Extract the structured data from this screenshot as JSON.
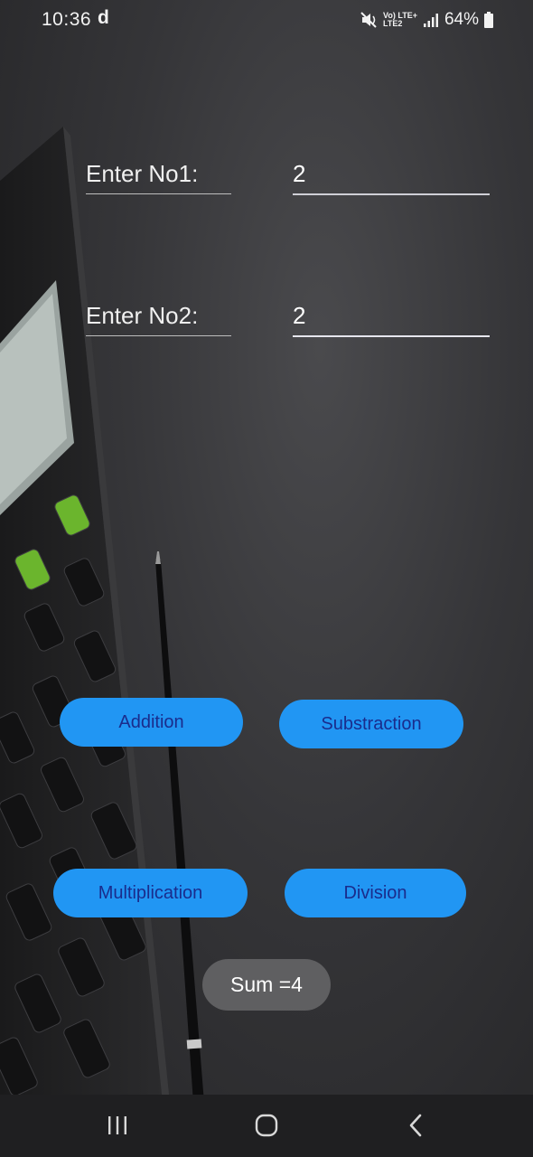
{
  "status_bar": {
    "time": "10:36",
    "app_indicator": "d",
    "network_line1": "Vo) LTE+",
    "network_line2": "LTE2",
    "battery_percent": "64%",
    "icons": [
      "mute-icon",
      "signal-icon",
      "battery-icon"
    ]
  },
  "form": {
    "label1": "Enter No1:",
    "value1": "2",
    "label2": "Enter No2:",
    "value2": "2"
  },
  "buttons": {
    "addition": "Addition",
    "subtraction": "Substraction",
    "multiplication": "Multiplication",
    "division": "Division"
  },
  "toast": {
    "message": "Sum =4"
  },
  "nav": {
    "icons": [
      "recents-icon",
      "home-icon",
      "back-icon"
    ]
  },
  "colors": {
    "button_bg": "#2196f3",
    "button_text": "#1a2c8c",
    "toast_bg": "#5f5f61",
    "background": "#353538"
  }
}
